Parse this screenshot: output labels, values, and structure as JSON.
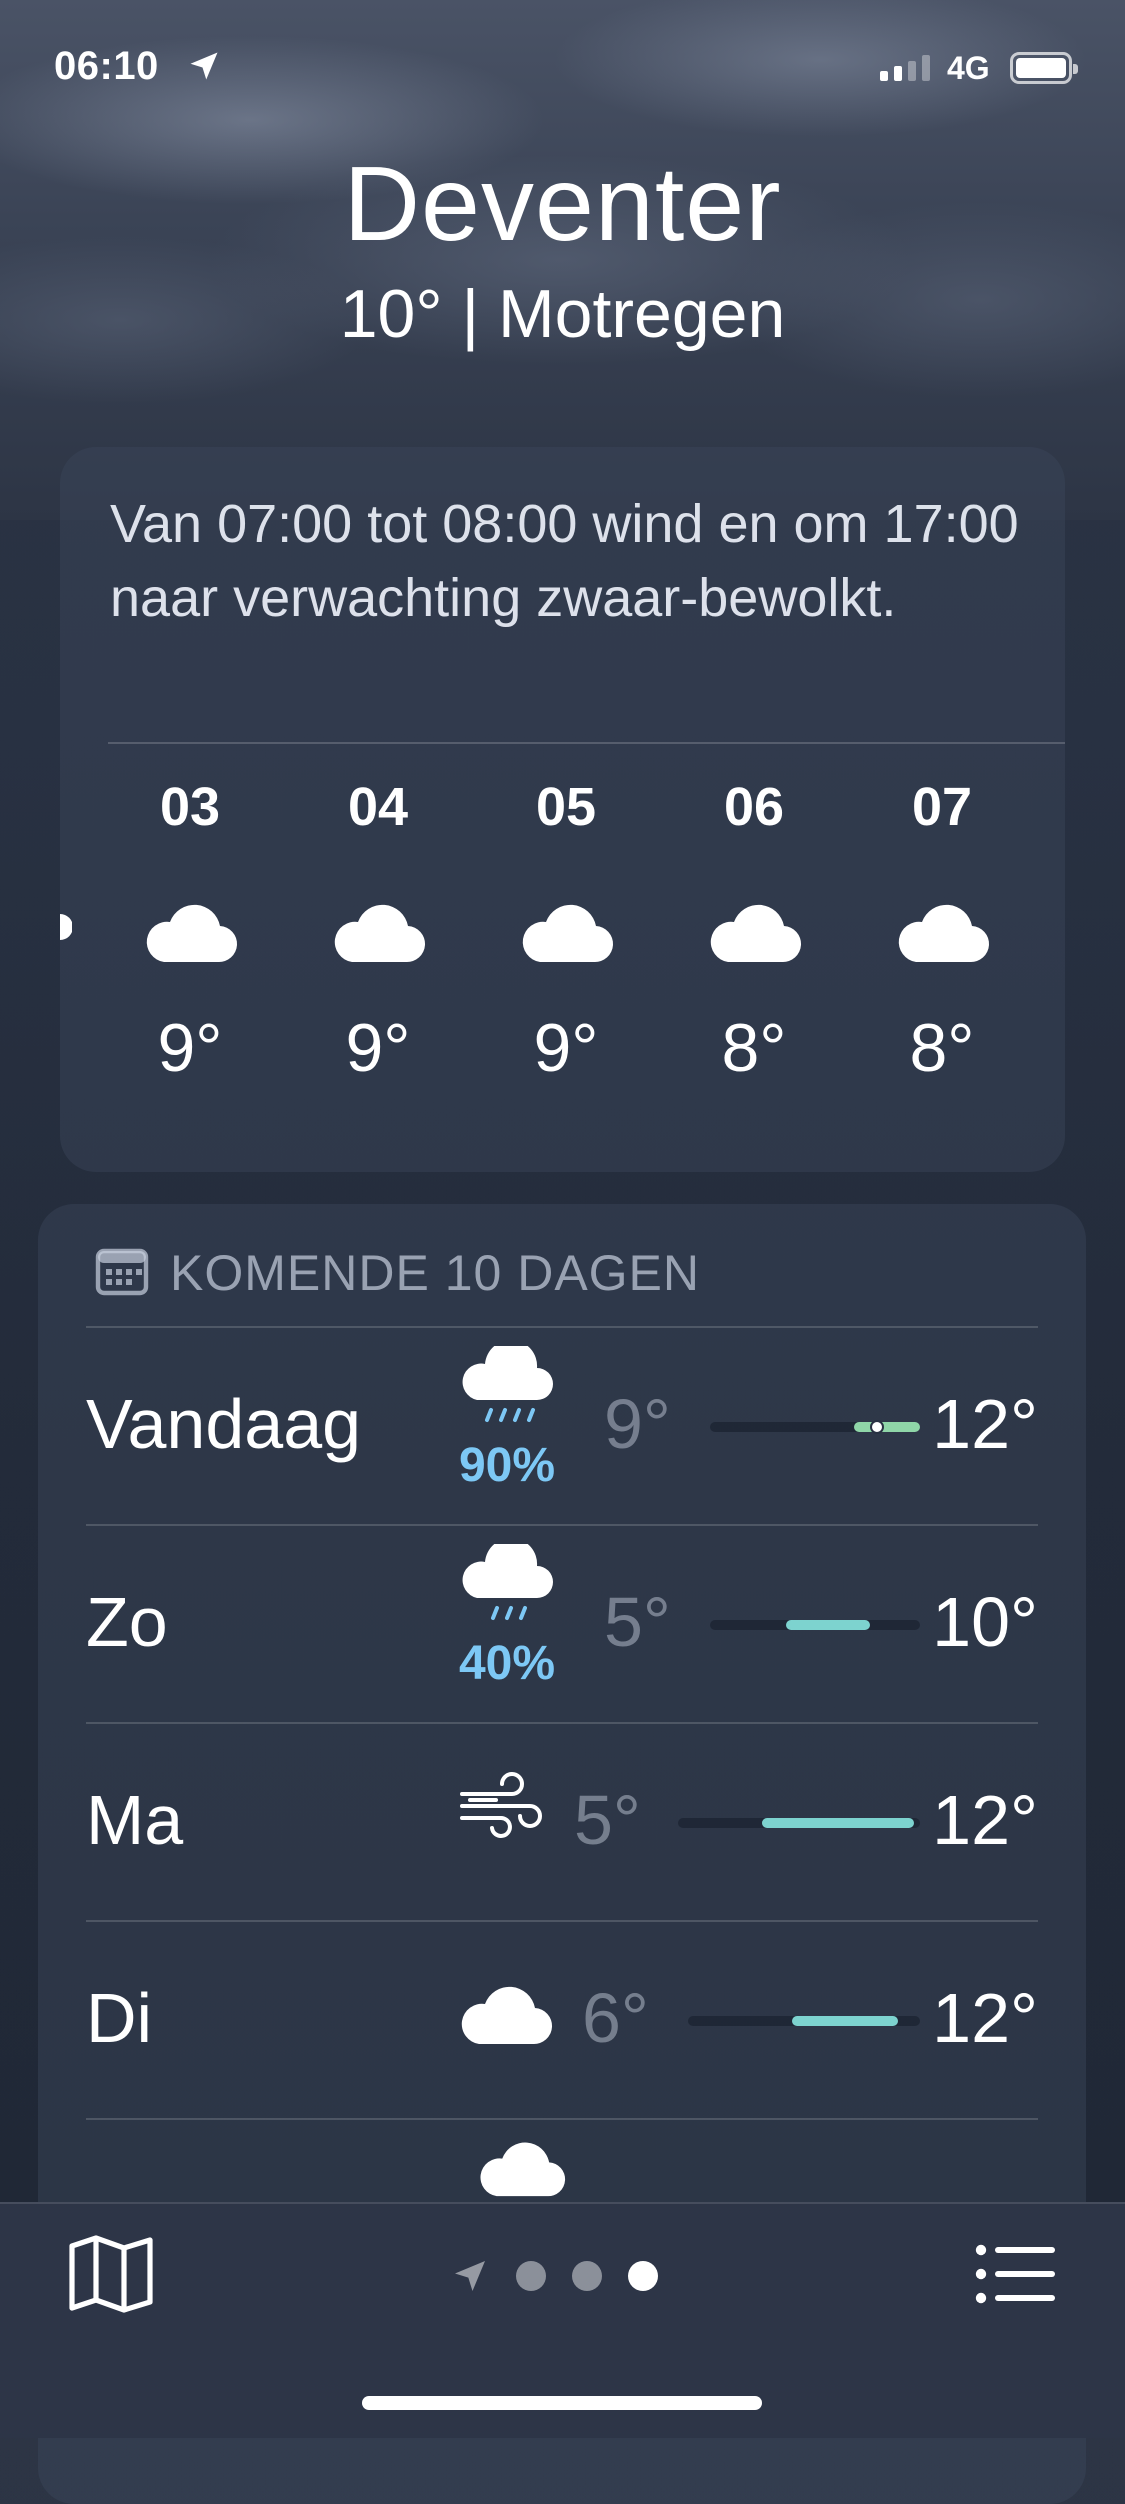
{
  "status": {
    "time": "06:10",
    "network": "4G"
  },
  "header": {
    "city": "Deventer",
    "summary": "10° | Motregen"
  },
  "hourly": {
    "description": "Van 07:00 tot 08:00 wind en om 17:00 naar verwachting zwaar-bewolkt.",
    "hours": [
      {
        "hour": "03",
        "icon": "cloud-icon",
        "temp": "9°"
      },
      {
        "hour": "04",
        "icon": "cloud-icon",
        "temp": "9°"
      },
      {
        "hour": "05",
        "icon": "cloud-icon",
        "temp": "9°"
      },
      {
        "hour": "06",
        "icon": "cloud-icon",
        "temp": "8°"
      },
      {
        "hour": "07",
        "icon": "cloud-icon",
        "temp": "8°"
      }
    ]
  },
  "daily": {
    "title": "KOMENDE 10 DAGEN",
    "days": [
      {
        "day": "Vandaag",
        "icon": "cloud-rain-icon",
        "precip": "90%",
        "low": "9°",
        "high": "12°"
      },
      {
        "day": "Zo",
        "icon": "cloud-rain-icon",
        "precip": "40%",
        "low": "5°",
        "high": "10°"
      },
      {
        "day": "Ma",
        "icon": "wind-icon",
        "precip": "",
        "low": "5°",
        "high": "12°"
      },
      {
        "day": "Di",
        "icon": "cloud-icon",
        "precip": "",
        "low": "6°",
        "high": "12°"
      }
    ]
  },
  "pager": {
    "pages": 3,
    "active_page": 3
  },
  "colors": {
    "precip": "#7dc8f5",
    "range_bar": "#7dd3cf"
  }
}
